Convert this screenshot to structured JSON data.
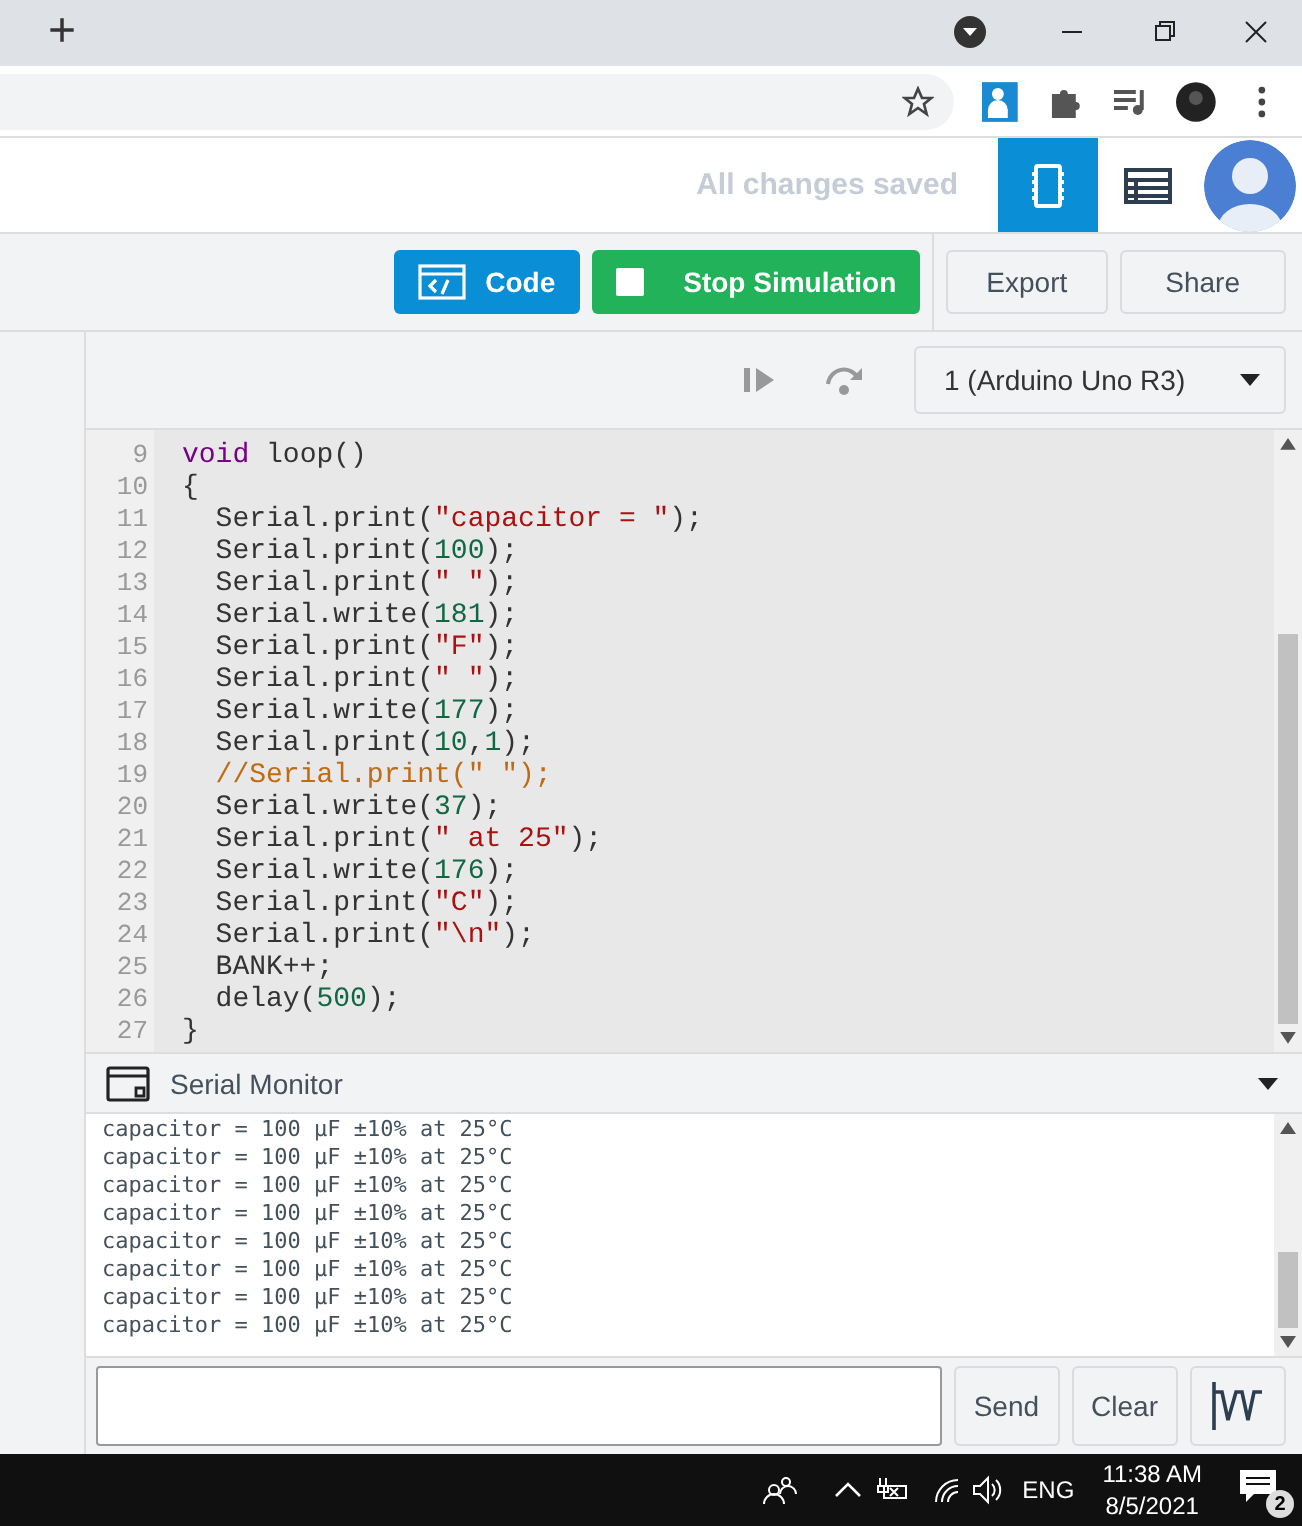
{
  "browser": {
    "new_tab": "+"
  },
  "header": {
    "status": "All changes saved",
    "views": [
      {
        "kind": "circuit",
        "selected": true
      },
      {
        "kind": "list",
        "selected": false
      }
    ]
  },
  "toolbar": {
    "code_button": "Code",
    "stop_button": "Stop Simulation",
    "export_button": "Export",
    "share_button": "Share"
  },
  "sim_toolbar": {
    "board_select": "1 (Arduino Uno R3)"
  },
  "code": [
    {
      "line": "9",
      "tokens": [
        {
          "kind": "keyword",
          "text": "void"
        },
        {
          "kind": "plain",
          "text": " loop()"
        }
      ]
    },
    {
      "line": "10",
      "tokens": [
        {
          "kind": "plain",
          "text": "{"
        }
      ]
    },
    {
      "line": "11",
      "tokens": [
        {
          "kind": "plain",
          "text": "  Serial.print("
        },
        {
          "kind": "string",
          "text": "\"capacitor = \""
        },
        {
          "kind": "plain",
          "text": ");"
        }
      ]
    },
    {
      "line": "12",
      "tokens": [
        {
          "kind": "plain",
          "text": "  Serial.print("
        },
        {
          "kind": "number",
          "text": "100"
        },
        {
          "kind": "plain",
          "text": ");"
        }
      ]
    },
    {
      "line": "13",
      "tokens": [
        {
          "kind": "plain",
          "text": "  Serial.print("
        },
        {
          "kind": "string",
          "text": "\" \""
        },
        {
          "kind": "plain",
          "text": ");"
        }
      ]
    },
    {
      "line": "14",
      "tokens": [
        {
          "kind": "plain",
          "text": "  Serial.write("
        },
        {
          "kind": "number",
          "text": "181"
        },
        {
          "kind": "plain",
          "text": ");"
        }
      ]
    },
    {
      "line": "15",
      "tokens": [
        {
          "kind": "plain",
          "text": "  Serial.print("
        },
        {
          "kind": "string",
          "text": "\"F\""
        },
        {
          "kind": "plain",
          "text": ");"
        }
      ]
    },
    {
      "line": "16",
      "tokens": [
        {
          "kind": "plain",
          "text": "  Serial.print("
        },
        {
          "kind": "string",
          "text": "\" \""
        },
        {
          "kind": "plain",
          "text": ");"
        }
      ]
    },
    {
      "line": "17",
      "tokens": [
        {
          "kind": "plain",
          "text": "  Serial.write("
        },
        {
          "kind": "number",
          "text": "177"
        },
        {
          "kind": "plain",
          "text": ");"
        }
      ]
    },
    {
      "line": "18",
      "tokens": [
        {
          "kind": "plain",
          "text": "  Serial.print("
        },
        {
          "kind": "number",
          "text": "10"
        },
        {
          "kind": "plain",
          "text": ","
        },
        {
          "kind": "number",
          "text": "1"
        },
        {
          "kind": "plain",
          "text": ");"
        }
      ]
    },
    {
      "line": "19",
      "tokens": [
        {
          "kind": "comment",
          "text": "  //Serial.print(\" \");"
        }
      ]
    },
    {
      "line": "20",
      "tokens": [
        {
          "kind": "plain",
          "text": "  Serial.write("
        },
        {
          "kind": "number",
          "text": "37"
        },
        {
          "kind": "plain",
          "text": ");"
        }
      ]
    },
    {
      "line": "21",
      "tokens": [
        {
          "kind": "plain",
          "text": "  Serial.print("
        },
        {
          "kind": "string",
          "text": "\" at 25\""
        },
        {
          "kind": "plain",
          "text": ");"
        }
      ]
    },
    {
      "line": "22",
      "tokens": [
        {
          "kind": "plain",
          "text": "  Serial.write("
        },
        {
          "kind": "number",
          "text": "176"
        },
        {
          "kind": "plain",
          "text": ");"
        }
      ]
    },
    {
      "line": "23",
      "tokens": [
        {
          "kind": "plain",
          "text": "  Serial.print("
        },
        {
          "kind": "string",
          "text": "\"C\""
        },
        {
          "kind": "plain",
          "text": ");"
        }
      ]
    },
    {
      "line": "24",
      "tokens": [
        {
          "kind": "plain",
          "text": "  Serial.print("
        },
        {
          "kind": "string",
          "text": "\"\\n\""
        },
        {
          "kind": "plain",
          "text": ");"
        }
      ]
    },
    {
      "line": "25",
      "tokens": [
        {
          "kind": "plain",
          "text": "  BANK++;"
        }
      ]
    },
    {
      "line": "26",
      "tokens": [
        {
          "kind": "plain",
          "text": "  delay("
        },
        {
          "kind": "number",
          "text": "500"
        },
        {
          "kind": "plain",
          "text": ");"
        }
      ]
    },
    {
      "line": "27",
      "tokens": [
        {
          "kind": "plain",
          "text": "}"
        }
      ]
    }
  ],
  "serial_monitor": {
    "title": "Serial Monitor",
    "output": [
      "capacitor = 100 µF ±10% at 25°C",
      "capacitor = 100 µF ±10% at 25°C",
      "capacitor = 100 µF ±10% at 25°C",
      "capacitor = 100 µF ±10% at 25°C",
      "capacitor = 100 µF ±10% at 25°C",
      "capacitor = 100 µF ±10% at 25°C",
      "capacitor = 100 µF ±10% at 25°C",
      "capacitor = 100 µF ±10% at 25°C"
    ],
    "send_button": "Send",
    "clear_button": "Clear"
  },
  "taskbar": {
    "language": "ENG",
    "time": "11:38 AM",
    "date": "8/5/2021",
    "notifications": "2"
  }
}
